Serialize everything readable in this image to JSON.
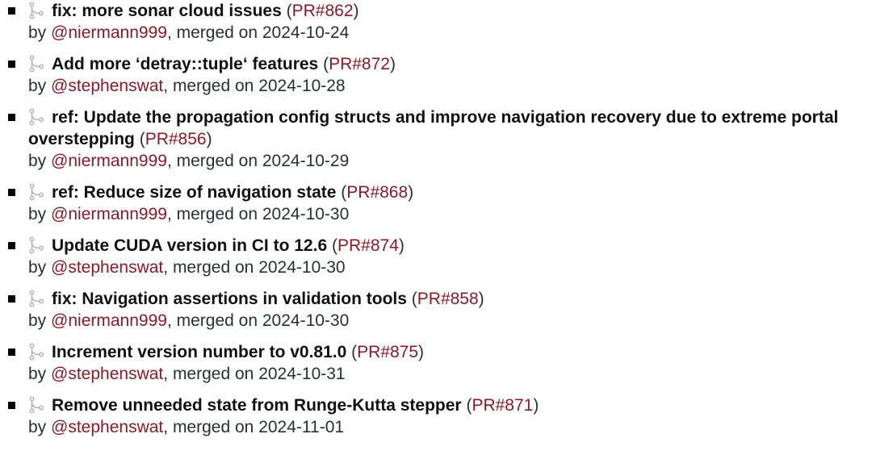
{
  "merge_icon": "git-merge-icon",
  "bullet_icon": "square-bullet-icon",
  "colors": {
    "link": "#8a1a26",
    "title": "#111111",
    "text": "#2a2f36",
    "icon": "#b8b8b8"
  },
  "labels": {
    "by": "by",
    "merged_on": "merged on"
  },
  "pull_requests": [
    {
      "title": "fix: more sonar cloud issues",
      "pr": "PR#862",
      "author": "@niermann999",
      "date": "2024-10-24"
    },
    {
      "title": "Add more ‘detray::tuple‘ features",
      "pr": "PR#872",
      "author": "@stephenswat",
      "date": "2024-10-28"
    },
    {
      "title": "ref: Update the propagation config structs and improve navigation recovery due to extreme portal overstepping",
      "pr": "PR#856",
      "author": "@niermann999",
      "date": "2024-10-29"
    },
    {
      "title": "ref: Reduce size of navigation state",
      "pr": "PR#868",
      "author": "@niermann999",
      "date": "2024-10-30"
    },
    {
      "title": "Update CUDA version in CI to 12.6",
      "pr": "PR#874",
      "author": "@stephenswat",
      "date": "2024-10-30"
    },
    {
      "title": "fix: Navigation assertions in validation tools",
      "pr": "PR#858",
      "author": "@niermann999",
      "date": "2024-10-30"
    },
    {
      "title": "Increment version number to v0.81.0",
      "pr": "PR#875",
      "author": "@stephenswat",
      "date": "2024-10-31"
    },
    {
      "title": "Remove unneeded state from Runge-Kutta stepper",
      "pr": "PR#871",
      "author": "@stephenswat",
      "date": "2024-11-01"
    }
  ]
}
